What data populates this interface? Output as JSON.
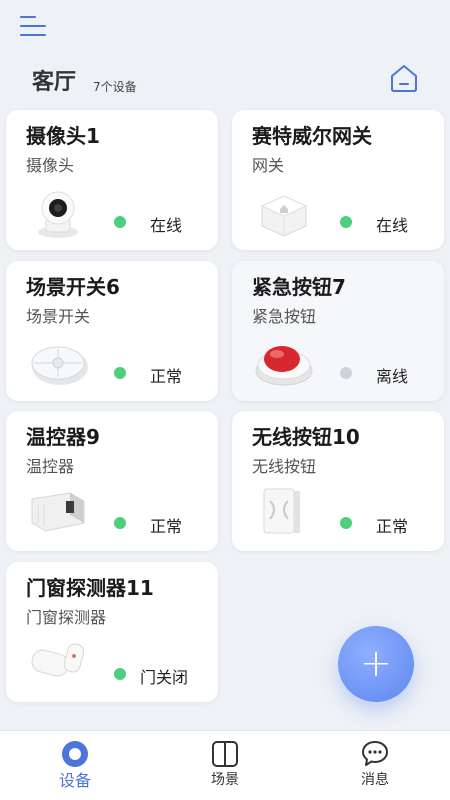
{
  "header": {
    "room_title": "客厅",
    "device_count": "7个设备"
  },
  "devices": [
    {
      "name": "摄像头1",
      "type": "摄像头",
      "status": "在线",
      "status_color": "#4cd07d",
      "image": "camera"
    },
    {
      "name": "赛特威尔网关",
      "type": "网关",
      "status": "在线",
      "status_color": "#4cd07d",
      "image": "gateway"
    },
    {
      "name": "场景开关6",
      "type": "场景开关",
      "status": "正常",
      "status_color": "#4cd07d",
      "image": "scene-switch"
    },
    {
      "name": "紧急按钮7",
      "type": "紧急按钮",
      "status": "离线",
      "status_color": "#cfd3d9",
      "image": "emergency-button"
    },
    {
      "name": "温控器9",
      "type": "温控器",
      "status": "正常",
      "status_color": "#4cd07d",
      "image": "thermostat"
    },
    {
      "name": "无线按钮10",
      "type": "无线按钮",
      "status": "正常",
      "status_color": "#4cd07d",
      "image": "wireless-button"
    },
    {
      "name": "门窗探测器11",
      "type": "门窗探测器",
      "status": "门关闭",
      "status_color": "#4cd07d",
      "image": "door-sensor"
    }
  ],
  "fab": {
    "label": "+"
  },
  "nav": {
    "devices": "设备",
    "scenes": "场景",
    "messages": "消息"
  },
  "colors": {
    "accent": "#4c74d9",
    "online": "#4cd07d",
    "offline": "#cfd3d9"
  }
}
